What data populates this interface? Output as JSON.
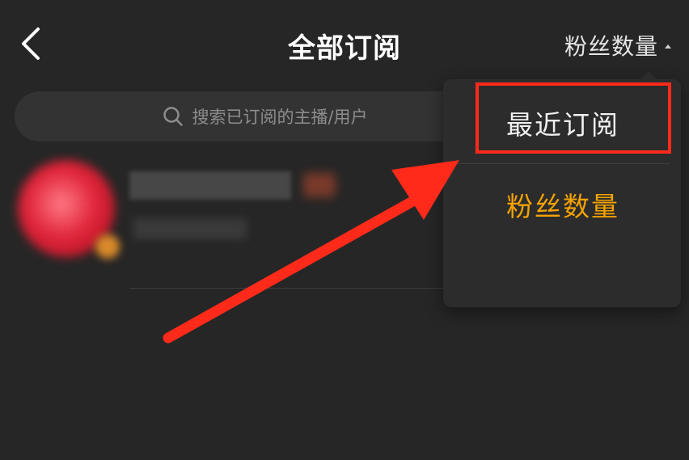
{
  "header": {
    "title": "全部订阅",
    "sort_label": "粉丝数量"
  },
  "search": {
    "placeholder": "搜索已订阅的主播/用户"
  },
  "dropdown": {
    "items": [
      {
        "label": "最近订阅",
        "highlighted": true
      },
      {
        "label": "粉丝数量",
        "selected": true
      }
    ]
  },
  "colors": {
    "background": "#262626",
    "accent": "#f5a300",
    "annotation": "#ff2a1a"
  },
  "icons": {
    "back": "chevron-left-icon",
    "search": "search-icon",
    "caret": "caret-up-icon"
  }
}
